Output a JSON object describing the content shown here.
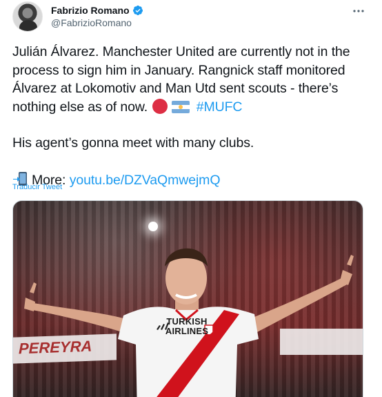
{
  "author": {
    "display_name": "Fabrizio Romano",
    "handle": "@FabrizioRomano"
  },
  "tweet": {
    "paragraph1_text": "Julián Álvarez. Manchester United are currently not in the process to sign him in January. Rangnick staff monitored Álvarez at Lokomotiv and Man Utd sent scouts - there’s nothing else as of now.",
    "hashtag": "#MUFC",
    "paragraph2": "His agent’s gonna meet with many clubs.",
    "more_label": "More:",
    "more_link": "youtu.be/DZVaQmwejmQ",
    "translate_label": "Traducir Tweet",
    "emoji": [
      "red-circle",
      "argentina-flag",
      "mobile-phone-arrow"
    ]
  },
  "media": {
    "banner_left": "PEREYRA",
    "sponsor_line1": "TURKISH",
    "sponsor_line2": "AIRLINES"
  },
  "colors": {
    "accent": "#1d9bf0",
    "text": "#0f1419",
    "secondary_text": "#536471",
    "jersey_stripe": "#d0121c"
  }
}
